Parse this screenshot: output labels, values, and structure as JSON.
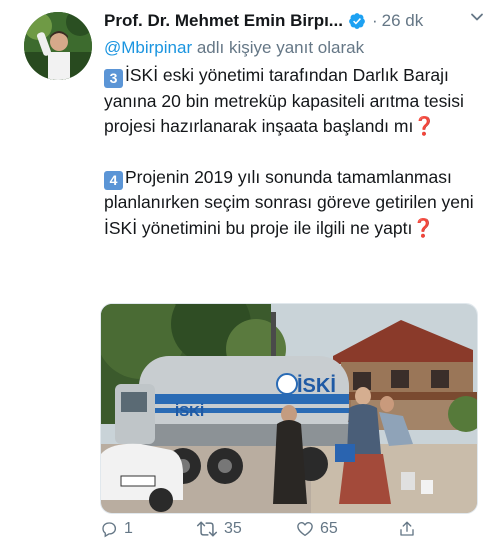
{
  "author": {
    "name": "Prof. Dr. Mehmet Emin Birpı...",
    "verified": true,
    "time": "26 dk"
  },
  "reply_context": {
    "handle": "@Mbirpinar",
    "text": " adlı kişiye yanıt olarak"
  },
  "tweet": {
    "para1_badge": "3",
    "para1_text": "İSKİ eski yönetimi tarafından Darlık Barajı yanına 20 bin metreküp kapasiteli arıtma tesisi projesi hazırlanarak inşaata başlandı mı",
    "para2_badge": "4",
    "para2_text": "Projenin 2019 yılı sonunda tamamlanması planlanırken seçim sonrası göreve getirilen yeni İSKİ yönetimini  bu proje ile ilgili ne yaptı",
    "question_mark": "❓"
  },
  "media": {
    "truck_logo": "İSKİ",
    "truck_logo_small": "İSKİ"
  },
  "actions": {
    "replies": "1",
    "retweets": "35",
    "likes": "65"
  },
  "colors": {
    "link": "#1b95e0",
    "verified": "#1da1f2",
    "muted": "#657786",
    "badge": "#5b95d6",
    "question": "#dd2e44"
  },
  "icons": [
    "verified-badge-icon",
    "chevron-down-icon",
    "reply-icon",
    "retweet-icon",
    "like-icon",
    "share-icon"
  ]
}
